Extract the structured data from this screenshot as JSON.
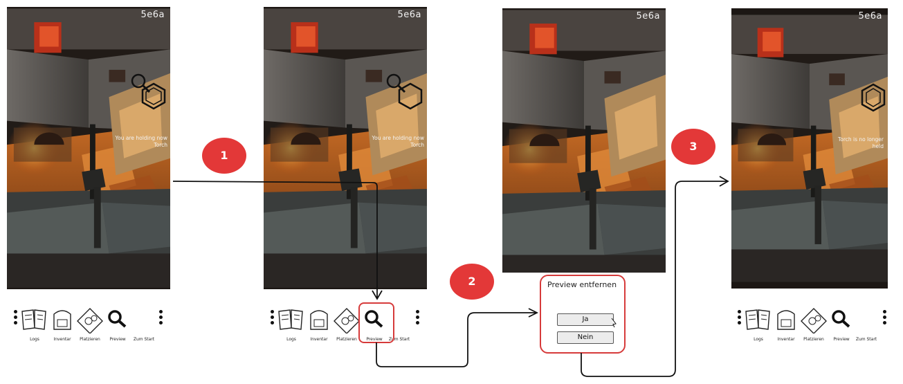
{
  "screens": [
    {
      "timer": "5e6a",
      "message": "You are holding now\nTorch"
    },
    {
      "timer": "5e6a",
      "message": "You are holding now\nTorch"
    },
    {
      "timer": "5e6a",
      "message": ""
    },
    {
      "timer": "5e6a",
      "message": "Torch is no longer\nheld"
    }
  ],
  "toolbar": {
    "logs": "Logs",
    "inventar": "Inventar",
    "platzieren": "Platzieren",
    "preview": "Preview",
    "zum_start": "Zum Start"
  },
  "dialog": {
    "title": "Preview entfernen",
    "yes": "Ja",
    "no": "Nein"
  },
  "steps": [
    "1",
    "2",
    "3"
  ],
  "colors": {
    "highlight": "#d63a3a",
    "badge": "#e33838",
    "arrow": "#111111"
  }
}
